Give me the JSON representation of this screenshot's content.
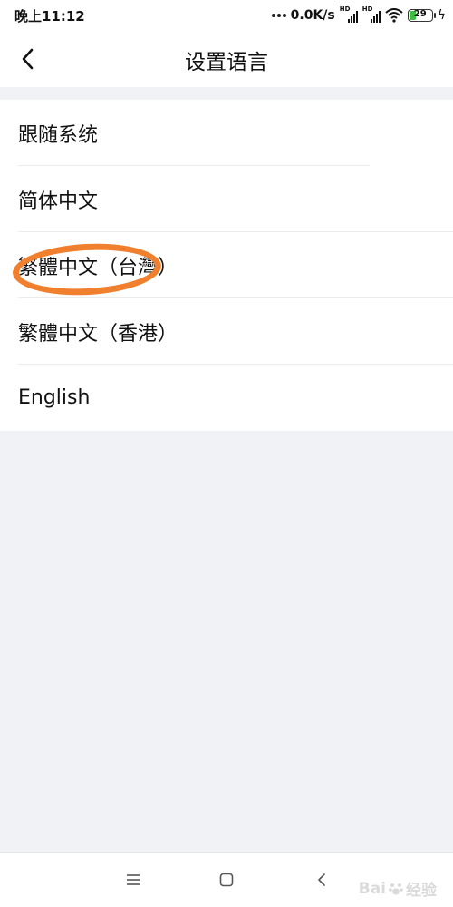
{
  "status_bar": {
    "time": "晚上11:12",
    "net_speed": "0.0K/s",
    "hd_label": "HD",
    "battery_percent": "29",
    "battery_level": 0.29,
    "icons": [
      "dots-icon",
      "signal-icon",
      "wifi-icon",
      "battery-icon",
      "charging-icon"
    ]
  },
  "header": {
    "title": "设置语言",
    "back_icon": "chevron-left-icon"
  },
  "languages": [
    {
      "label": "跟随系统"
    },
    {
      "label": "简体中文"
    },
    {
      "label": "繁體中文（台灣）"
    },
    {
      "label": "繁體中文（香港）"
    },
    {
      "label": "English"
    }
  ],
  "annotation": {
    "highlighted_item": "繁體中文（台灣）",
    "color": "#f07f2e"
  },
  "nav_bar": {
    "icons": [
      "menu-icon",
      "home-square-icon",
      "back-arrow-icon"
    ]
  },
  "watermark": {
    "text": "Bai",
    "suffix": "经验"
  },
  "colors": {
    "background": "#f1f2f6",
    "surface": "#ffffff",
    "battery_fill": "#3fbf3f"
  }
}
